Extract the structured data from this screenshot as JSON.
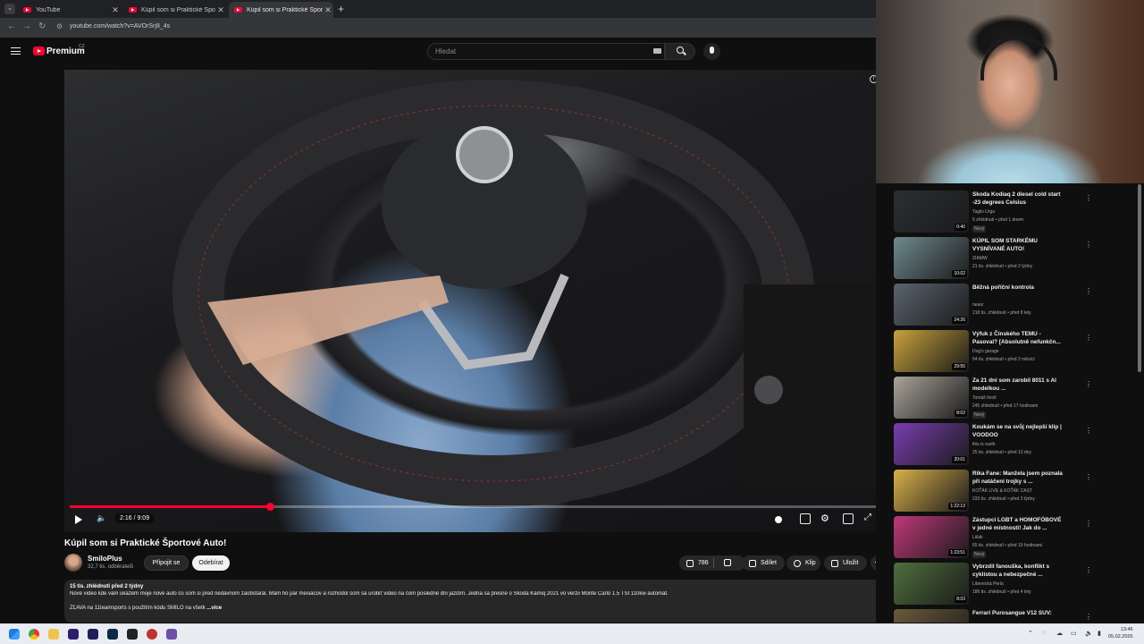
{
  "browser": {
    "tabs": [
      {
        "label": "YouTube",
        "active": false
      },
      {
        "label": "Kúpil som si Praktické Športové",
        "active": false
      },
      {
        "label": "Kúpil som si Praktické Športové",
        "active": true
      }
    ],
    "new_tab": "+",
    "url": "youtube.com/watch?v=AVOrSrj8_4s"
  },
  "youtube": {
    "brand": "Premium",
    "country": "CZ",
    "search_placeholder": "Hledat"
  },
  "player": {
    "current_time": "2:16",
    "duration": "9:09",
    "time_display": "2:16 / 9:09",
    "progress_fraction": 0.2477
  },
  "video": {
    "title": "Kúpil som si Praktické Športové Auto!",
    "channel": "SmiloPlus",
    "subscribers": "32,7 tis. odběratelů",
    "join_label": "Připojit se",
    "subscribe_label": "Odebírat",
    "likes": "786",
    "share_label": "Sdílet",
    "clip_label": "Klip",
    "save_label": "Uložit",
    "more_label": "⋯"
  },
  "description": {
    "meta": "15 tis. zhlédnutí  před 2 týdny",
    "text": "Nové video kde vám ukážem moje nové auto čo som si pred nedávnom zaobstaral. Mám ho pár mesiacov a rozhodol som sa urobiť video na čom posledné dni jazdím. Jedná sa presne o Škoda Kamiq 2021 vo verzii Monte Carlo 1.5 TSI 110kw automat.",
    "discount": "ZĽAVA na 11teamsports s použitím kódu SMILO na všetk",
    "more": "...více"
  },
  "recommendations": [
    {
      "title": "Skoda Kodiaq 2 diesel cold start -23 degrees Celsius",
      "channel": "Tagiis Urga",
      "meta": "6 zhlédnutí • před 1 dnem",
      "badge": "Nový",
      "duration": "0:40",
      "thumb": "#2b2e33"
    },
    {
      "title": "KÚPIL SOM STARKÉMU VYSNÍVANÉ AUTO!",
      "channel": "ZIAMW",
      "meta": "21 tis. zhlédnutí • před 2 týdny",
      "badge": "",
      "duration": "10:02",
      "thumb": "#6f8a8f"
    },
    {
      "title": "Běžná poříční kontrola",
      "channel": "neasi",
      "meta": "218 tis. zhlédnutí • před 8 lety",
      "badge": "",
      "duration": "24:26",
      "thumb": "#5b6470"
    },
    {
      "title": "Výfuk z Čínského TEMU - Pasoval? [Absolutně nefunkčn...",
      "channel": "Dog's garage",
      "meta": "54 tis. zhlédnutí • před 2 měsíci",
      "badge": "",
      "duration": "29:55",
      "thumb": "#c8a23a"
    },
    {
      "title": "Za 21 dní som zarobil 8011 s AI modelkou ...",
      "channel": "Tomáš Itvoit",
      "meta": "245 zhlédnutí • před 17 hodinami",
      "badge": "Nový",
      "duration": "8:02",
      "thumb": "#a9a49a"
    },
    {
      "title": "Koukám se na svůj nejlepší klip | VOODOO",
      "channel": "this is earth",
      "meta": "25 tis. zhlédnutí • před 13 dny",
      "badge": "",
      "duration": "20:01",
      "thumb": "#7a3db0"
    },
    {
      "title": "Ríka Fane: Manžela jsem poznala při natáčení trojky s ...",
      "channel": "KOŤÁK LIVE & KOŤÁK CAST",
      "meta": "233 tis. zhlédnutí • před 3 týdny",
      "badge": "",
      "duration": "1:22:13",
      "thumb": "#d8b04a"
    },
    {
      "title": "Zástupci LGBT a HOMOFÓBOVÉ v jedné místnosti! Jak do ...",
      "channel": "Lišák",
      "meta": "65 tis. zhlédnutí • před 19 hodinami",
      "badge": "Nový",
      "duration": "1:23:51",
      "thumb": "#c0387a"
    },
    {
      "title": "Vybrzdil fanouška, konflikt s cyklistou a nebezpečné ...",
      "channel": "Liberecká Perla",
      "meta": "186 tis. zhlédnutí • před 4 lety",
      "badge": "",
      "duration": "8:03",
      "thumb": "#4f6f3c"
    },
    {
      "title": "Ferrari Purosangue V12 SUV:",
      "channel": "",
      "meta": "",
      "badge": "",
      "duration": "",
      "thumb": "#6a5a3a"
    }
  ],
  "taskbar": {
    "time": "13:46",
    "date": "05.02.2026"
  }
}
